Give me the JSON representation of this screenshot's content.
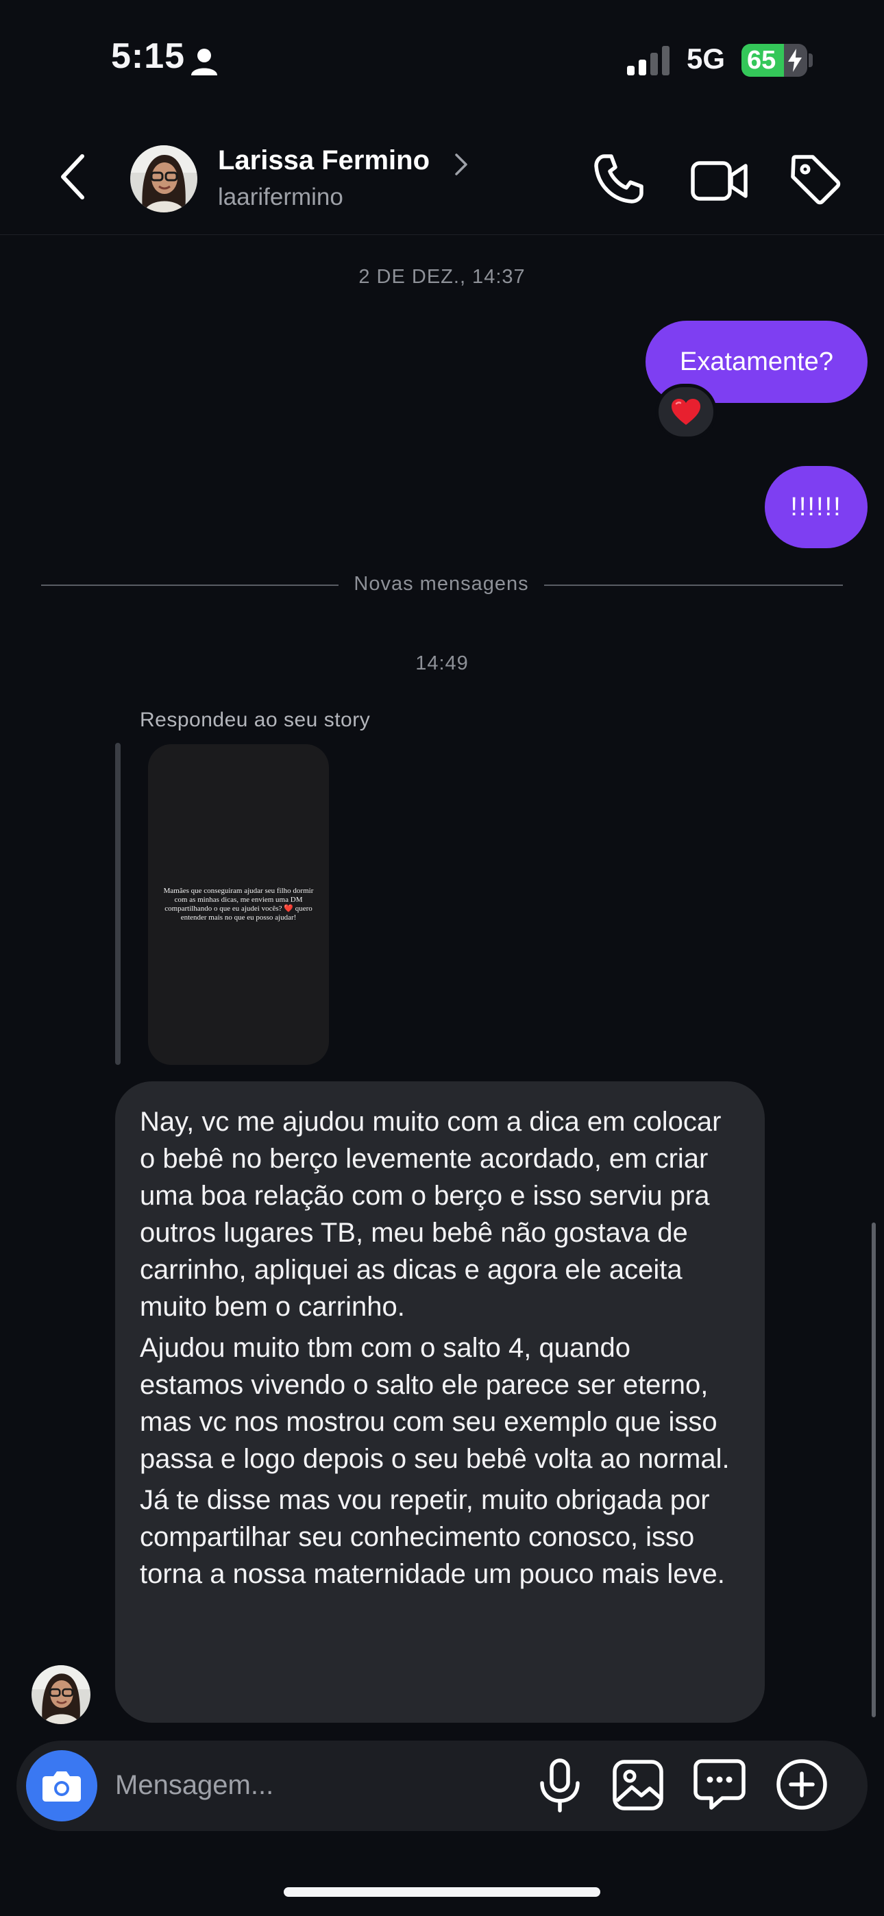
{
  "status_bar": {
    "time": "5:15",
    "network": "5G",
    "battery": "65",
    "battery_level": 0.65,
    "icons": [
      "person-icon",
      "signal-icon",
      "battery-charging-icon"
    ]
  },
  "header": {
    "contact_name": "Larissa Fermino",
    "contact_handle": "laarifermino",
    "icons": [
      "back-icon",
      "chevron-right-icon",
      "phone-icon",
      "video-icon",
      "tag-icon"
    ]
  },
  "messages": {
    "date_separator": "2 DE DEZ., 14:37",
    "sent": [
      {
        "text": "Exatamente?",
        "reaction": "❤️"
      },
      {
        "text": "!!!!!!"
      }
    ],
    "new_messages_label": "Novas mensagens",
    "time_separator": "14:49",
    "story_reply": {
      "label": "Respondeu ao seu story",
      "story_text": "Mamães que conseguiram ajudar seu filho dormir com as minhas dicas, me enviem uma DM compartilhando o que eu ajudei vocês? ❤️ quero entender mais no que eu posso ajudar!"
    },
    "received": {
      "paragraphs": [
        "Nay, vc me ajudou muito com a dica em colocar o bebê no berço levemente acordado, em criar uma boa relação com o berço e isso serviu pra outros lugares TB, meu bebê não gostava de carrinho, apliquei as dicas e agora ele aceita muito bem o carrinho.",
        "Ajudou muito tbm com o salto 4, quando estamos vivendo o salto ele parece ser eterno, mas vc nos mostrou com seu exemplo que isso passa e logo depois o seu bebê volta ao normal.",
        "Já te disse mas vou repetir, muito obrigada por compartilhar seu conhecimento conosco, isso torna a nossa maternidade um pouco mais leve."
      ]
    }
  },
  "composer": {
    "placeholder": "Mensagem...",
    "icons": [
      "camera-icon",
      "microphone-icon",
      "gallery-icon",
      "sticker-icon",
      "plus-icon"
    ]
  },
  "colors": {
    "background": "#0b0d12",
    "sent_bubble": "#7e3ff2",
    "received_bubble": "#26282d",
    "camera_button": "#3a78f2",
    "battery": "#34c759"
  }
}
